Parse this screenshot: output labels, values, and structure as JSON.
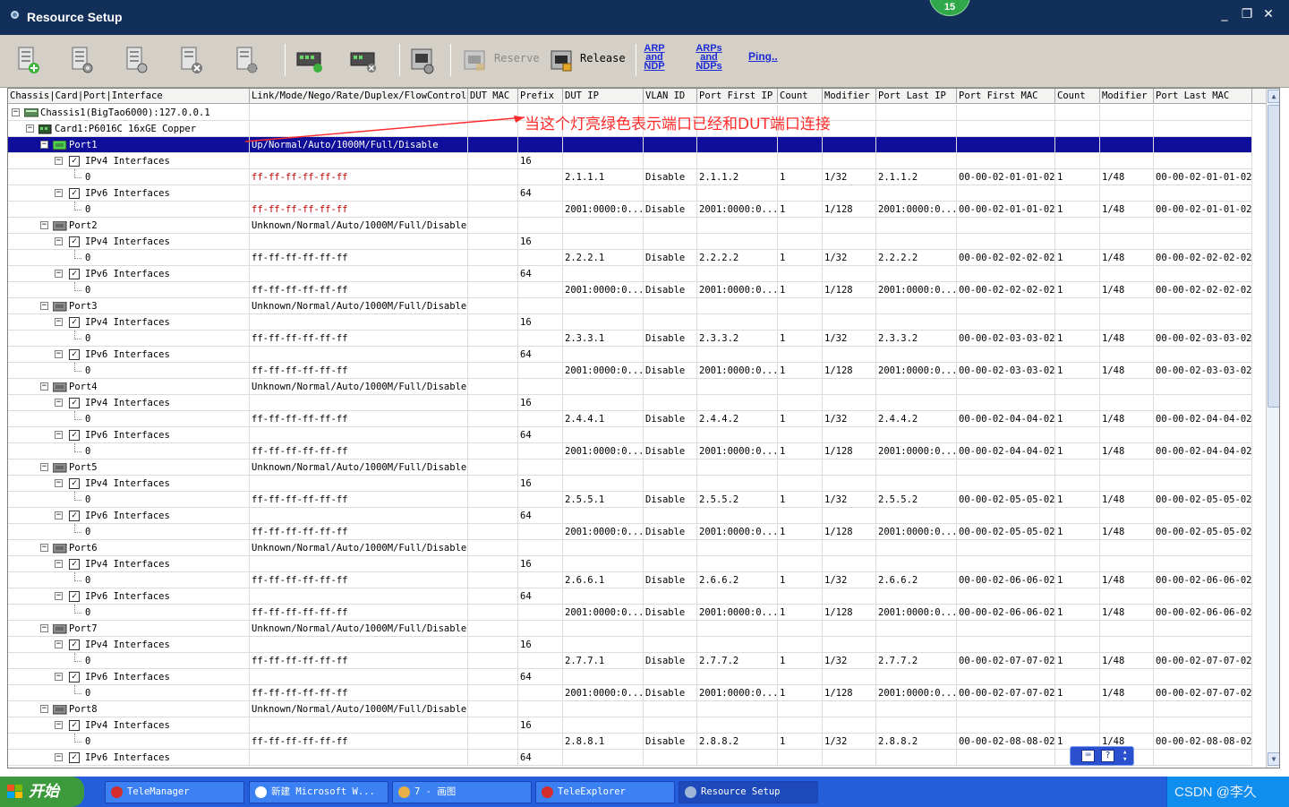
{
  "window": {
    "title": "Resource Setup",
    "badge": "15",
    "minimize": "_",
    "restore": "❐",
    "close": "✕"
  },
  "toolbar": {
    "icons": [
      "add-chassis-icon",
      "chassis-properties-icon",
      "card-properties-icon",
      "remove-chassis-icon",
      "chassis-settings-icon",
      "add-card-icon",
      "remove-card-icon",
      "port-settings-icon"
    ],
    "reserve_label": "Reserve",
    "release_label": "Release",
    "arp_ndp_label": [
      "ARP",
      "and",
      "NDP"
    ],
    "arps_ndps_label": [
      "ARPs",
      "and",
      "NDPs"
    ],
    "ping_label": "Ping.."
  },
  "grid": {
    "headers": [
      "Chassis|Card|Port|Interface",
      "Link/Mode/Nego/Rate/Duplex/FlowControl",
      "DUT MAC",
      "Prefix",
      "DUT IP",
      "VLAN ID",
      "Port First IP",
      "Count",
      "Modifier",
      "Port Last IP",
      "Port First MAC",
      "Count",
      "Modifier",
      "Port Last MAC"
    ],
    "chassis": "Chassis1(BigTao6000):127.0.0.1",
    "card": "Card1:P6016C 16xGE Copper",
    "rows": [
      {
        "level": 2,
        "kind": "port",
        "label": "Port1",
        "link": "Up/Normal/Auto/1000M/Full/Disable",
        "selected": true
      },
      {
        "level": 3,
        "kind": "iface",
        "label": "IPv4 Interfaces",
        "prefix": "16"
      },
      {
        "level": 4,
        "kind": "entry",
        "label": "0",
        "mac": "ff-ff-ff-ff-ff-ff",
        "mac_red": true,
        "dut_ip": "2.1.1.1",
        "vlan": "Disable",
        "first_ip": "2.1.1.2",
        "count": "1",
        "mod": "1/32",
        "last_ip": "2.1.1.2",
        "first_mac": "00-00-02-01-01-02",
        "count2": "1",
        "mod2": "1/48",
        "last_mac": "00-00-02-01-01-02"
      },
      {
        "level": 3,
        "kind": "iface",
        "label": "IPv6 Interfaces",
        "prefix": "64"
      },
      {
        "level": 4,
        "kind": "entry",
        "label": "0",
        "mac": "ff-ff-ff-ff-ff-ff",
        "mac_red": true,
        "dut_ip": "2001:0000:0...",
        "vlan": "Disable",
        "first_ip": "2001:0000:0...",
        "count": "1",
        "mod": "1/128",
        "last_ip": "2001:0000:0...",
        "first_mac": "00-00-02-01-01-02",
        "count2": "1",
        "mod2": "1/48",
        "last_mac": "00-00-02-01-01-02"
      },
      {
        "level": 2,
        "kind": "port",
        "label": "Port2",
        "link": "Unknown/Normal/Auto/1000M/Full/Disable"
      },
      {
        "level": 3,
        "kind": "iface",
        "label": "IPv4 Interfaces",
        "prefix": "16"
      },
      {
        "level": 4,
        "kind": "entry",
        "label": "0",
        "mac": "ff-ff-ff-ff-ff-ff",
        "dut_ip": "2.2.2.1",
        "vlan": "Disable",
        "first_ip": "2.2.2.2",
        "count": "1",
        "mod": "1/32",
        "last_ip": "2.2.2.2",
        "first_mac": "00-00-02-02-02-02",
        "count2": "1",
        "mod2": "1/48",
        "last_mac": "00-00-02-02-02-02"
      },
      {
        "level": 3,
        "kind": "iface",
        "label": "IPv6 Interfaces",
        "prefix": "64"
      },
      {
        "level": 4,
        "kind": "entry",
        "label": "0",
        "mac": "ff-ff-ff-ff-ff-ff",
        "dut_ip": "2001:0000:0...",
        "vlan": "Disable",
        "first_ip": "2001:0000:0...",
        "count": "1",
        "mod": "1/128",
        "last_ip": "2001:0000:0...",
        "first_mac": "00-00-02-02-02-02",
        "count2": "1",
        "mod2": "1/48",
        "last_mac": "00-00-02-02-02-02"
      },
      {
        "level": 2,
        "kind": "port",
        "label": "Port3",
        "link": "Unknown/Normal/Auto/1000M/Full/Disable"
      },
      {
        "level": 3,
        "kind": "iface",
        "label": "IPv4 Interfaces",
        "prefix": "16"
      },
      {
        "level": 4,
        "kind": "entry",
        "label": "0",
        "mac": "ff-ff-ff-ff-ff-ff",
        "dut_ip": "2.3.3.1",
        "vlan": "Disable",
        "first_ip": "2.3.3.2",
        "count": "1",
        "mod": "1/32",
        "last_ip": "2.3.3.2",
        "first_mac": "00-00-02-03-03-02",
        "count2": "1",
        "mod2": "1/48",
        "last_mac": "00-00-02-03-03-02"
      },
      {
        "level": 3,
        "kind": "iface",
        "label": "IPv6 Interfaces",
        "prefix": "64"
      },
      {
        "level": 4,
        "kind": "entry",
        "label": "0",
        "mac": "ff-ff-ff-ff-ff-ff",
        "dut_ip": "2001:0000:0...",
        "vlan": "Disable",
        "first_ip": "2001:0000:0...",
        "count": "1",
        "mod": "1/128",
        "last_ip": "2001:0000:0...",
        "first_mac": "00-00-02-03-03-02",
        "count2": "1",
        "mod2": "1/48",
        "last_mac": "00-00-02-03-03-02"
      },
      {
        "level": 2,
        "kind": "port",
        "label": "Port4",
        "link": "Unknown/Normal/Auto/1000M/Full/Disable"
      },
      {
        "level": 3,
        "kind": "iface",
        "label": "IPv4 Interfaces",
        "prefix": "16"
      },
      {
        "level": 4,
        "kind": "entry",
        "label": "0",
        "mac": "ff-ff-ff-ff-ff-ff",
        "dut_ip": "2.4.4.1",
        "vlan": "Disable",
        "first_ip": "2.4.4.2",
        "count": "1",
        "mod": "1/32",
        "last_ip": "2.4.4.2",
        "first_mac": "00-00-02-04-04-02",
        "count2": "1",
        "mod2": "1/48",
        "last_mac": "00-00-02-04-04-02"
      },
      {
        "level": 3,
        "kind": "iface",
        "label": "IPv6 Interfaces",
        "prefix": "64"
      },
      {
        "level": 4,
        "kind": "entry",
        "label": "0",
        "mac": "ff-ff-ff-ff-ff-ff",
        "dut_ip": "2001:0000:0...",
        "vlan": "Disable",
        "first_ip": "2001:0000:0...",
        "count": "1",
        "mod": "1/128",
        "last_ip": "2001:0000:0...",
        "first_mac": "00-00-02-04-04-02",
        "count2": "1",
        "mod2": "1/48",
        "last_mac": "00-00-02-04-04-02"
      },
      {
        "level": 2,
        "kind": "port",
        "label": "Port5",
        "link": "Unknown/Normal/Auto/1000M/Full/Disable"
      },
      {
        "level": 3,
        "kind": "iface",
        "label": "IPv4 Interfaces",
        "prefix": "16"
      },
      {
        "level": 4,
        "kind": "entry",
        "label": "0",
        "mac": "ff-ff-ff-ff-ff-ff",
        "dut_ip": "2.5.5.1",
        "vlan": "Disable",
        "first_ip": "2.5.5.2",
        "count": "1",
        "mod": "1/32",
        "last_ip": "2.5.5.2",
        "first_mac": "00-00-02-05-05-02",
        "count2": "1",
        "mod2": "1/48",
        "last_mac": "00-00-02-05-05-02"
      },
      {
        "level": 3,
        "kind": "iface",
        "label": "IPv6 Interfaces",
        "prefix": "64"
      },
      {
        "level": 4,
        "kind": "entry",
        "label": "0",
        "mac": "ff-ff-ff-ff-ff-ff",
        "dut_ip": "2001:0000:0...",
        "vlan": "Disable",
        "first_ip": "2001:0000:0...",
        "count": "1",
        "mod": "1/128",
        "last_ip": "2001:0000:0...",
        "first_mac": "00-00-02-05-05-02",
        "count2": "1",
        "mod2": "1/48",
        "last_mac": "00-00-02-05-05-02"
      },
      {
        "level": 2,
        "kind": "port",
        "label": "Port6",
        "link": "Unknown/Normal/Auto/1000M/Full/Disable"
      },
      {
        "level": 3,
        "kind": "iface",
        "label": "IPv4 Interfaces",
        "prefix": "16"
      },
      {
        "level": 4,
        "kind": "entry",
        "label": "0",
        "mac": "ff-ff-ff-ff-ff-ff",
        "dut_ip": "2.6.6.1",
        "vlan": "Disable",
        "first_ip": "2.6.6.2",
        "count": "1",
        "mod": "1/32",
        "last_ip": "2.6.6.2",
        "first_mac": "00-00-02-06-06-02",
        "count2": "1",
        "mod2": "1/48",
        "last_mac": "00-00-02-06-06-02"
      },
      {
        "level": 3,
        "kind": "iface",
        "label": "IPv6 Interfaces",
        "prefix": "64"
      },
      {
        "level": 4,
        "kind": "entry",
        "label": "0",
        "mac": "ff-ff-ff-ff-ff-ff",
        "dut_ip": "2001:0000:0...",
        "vlan": "Disable",
        "first_ip": "2001:0000:0...",
        "count": "1",
        "mod": "1/128",
        "last_ip": "2001:0000:0...",
        "first_mac": "00-00-02-06-06-02",
        "count2": "1",
        "mod2": "1/48",
        "last_mac": "00-00-02-06-06-02"
      },
      {
        "level": 2,
        "kind": "port",
        "label": "Port7",
        "link": "Unknown/Normal/Auto/1000M/Full/Disable"
      },
      {
        "level": 3,
        "kind": "iface",
        "label": "IPv4 Interfaces",
        "prefix": "16"
      },
      {
        "level": 4,
        "kind": "entry",
        "label": "0",
        "mac": "ff-ff-ff-ff-ff-ff",
        "dut_ip": "2.7.7.1",
        "vlan": "Disable",
        "first_ip": "2.7.7.2",
        "count": "1",
        "mod": "1/32",
        "last_ip": "2.7.7.2",
        "first_mac": "00-00-02-07-07-02",
        "count2": "1",
        "mod2": "1/48",
        "last_mac": "00-00-02-07-07-02"
      },
      {
        "level": 3,
        "kind": "iface",
        "label": "IPv6 Interfaces",
        "prefix": "64"
      },
      {
        "level": 4,
        "kind": "entry",
        "label": "0",
        "mac": "ff-ff-ff-ff-ff-ff",
        "dut_ip": "2001:0000:0...",
        "vlan": "Disable",
        "first_ip": "2001:0000:0...",
        "count": "1",
        "mod": "1/128",
        "last_ip": "2001:0000:0...",
        "first_mac": "00-00-02-07-07-02",
        "count2": "1",
        "mod2": "1/48",
        "last_mac": "00-00-02-07-07-02"
      },
      {
        "level": 2,
        "kind": "port",
        "label": "Port8",
        "link": "Unknown/Normal/Auto/1000M/Full/Disable"
      },
      {
        "level": 3,
        "kind": "iface",
        "label": "IPv4 Interfaces",
        "prefix": "16"
      },
      {
        "level": 4,
        "kind": "entry",
        "label": "0",
        "mac": "ff-ff-ff-ff-ff-ff",
        "dut_ip": "2.8.8.1",
        "vlan": "Disable",
        "first_ip": "2.8.8.2",
        "count": "1",
        "mod": "1/32",
        "last_ip": "2.8.8.2",
        "first_mac": "00-00-02-08-08-02",
        "count2": "1",
        "mod2": "1/48",
        "last_mac": "00-00-02-08-08-02"
      },
      {
        "level": 3,
        "kind": "iface",
        "label": "IPv6 Interfaces",
        "prefix": "64"
      }
    ]
  },
  "annotation": "当这个灯亮绿色表示端口已经和DUT端口连接",
  "taskbar": {
    "start": "开始",
    "tasks": [
      {
        "label": "TeleManager",
        "icon_color": "#d42c2c"
      },
      {
        "label": "新建 Microsoft W...",
        "icon_color": "#ffffff"
      },
      {
        "label": "7 - 画图",
        "icon_color": "#e8b048"
      },
      {
        "label": "TeleExplorer",
        "icon_color": "#d42c2c"
      },
      {
        "label": "Resource Setup",
        "icon_color": "#9fb6d8"
      }
    ],
    "watermark": "CSDN @李久"
  },
  "colors": {
    "titlebar": "#112f59",
    "selection": "#0e0e9a",
    "annotation": "#ff2a2a",
    "link_blue": "#1c2cd6"
  }
}
